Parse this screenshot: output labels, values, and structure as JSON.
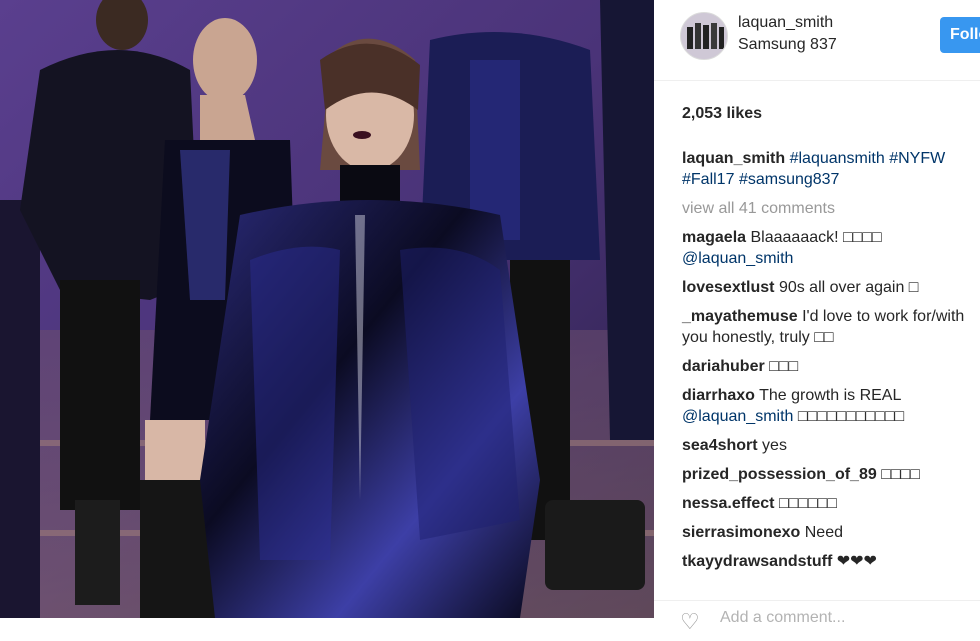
{
  "post": {
    "username": "laquan_smith",
    "location": "Samsung 837",
    "follow_label": "Follow",
    "likes": "2,053 likes",
    "caption_user": "laquan_smith",
    "caption_tags": [
      "#laquansmith",
      "#NYFW",
      "#Fall17",
      "#samsung837"
    ],
    "view_all": "view all 41 comments",
    "add_comment_placeholder": "Add a comment..."
  },
  "comments": [
    {
      "user": "magaela",
      "text": "Blaaaaaack! □□□□",
      "mention": "@laquan_smith",
      "tail": ""
    },
    {
      "user": "lovesextlust",
      "text": "90s all over again □",
      "mention": "",
      "tail": ""
    },
    {
      "user": "_mayathemuse",
      "text": "I'd love to work for/with you honestly, truly □□",
      "mention": "",
      "tail": ""
    },
    {
      "user": "dariahuber",
      "text": "□□□",
      "mention": "",
      "tail": ""
    },
    {
      "user": "diarrhaxo",
      "text": "The growth is REAL",
      "mention": "@laquan_smith",
      "tail": " □□□□□□□□□□□"
    },
    {
      "user": "sea4short",
      "text": "yes",
      "mention": "",
      "tail": ""
    },
    {
      "user": "prized_possession_of_89",
      "text": "□□□□",
      "mention": "",
      "tail": ""
    },
    {
      "user": "nessa.effect",
      "text": "□□□□□□",
      "mention": "",
      "tail": ""
    },
    {
      "user": "sierrasimonexo",
      "text": "Need",
      "mention": "",
      "tail": ""
    },
    {
      "user": "tkayydrawsandstuff",
      "text": "❤❤❤",
      "mention": "",
      "tail": ""
    }
  ],
  "icons": {
    "like": "heart-outline-icon"
  },
  "colors": {
    "follow_button": "#3897f0",
    "hashtag": "#003569",
    "muted": "#999999"
  }
}
